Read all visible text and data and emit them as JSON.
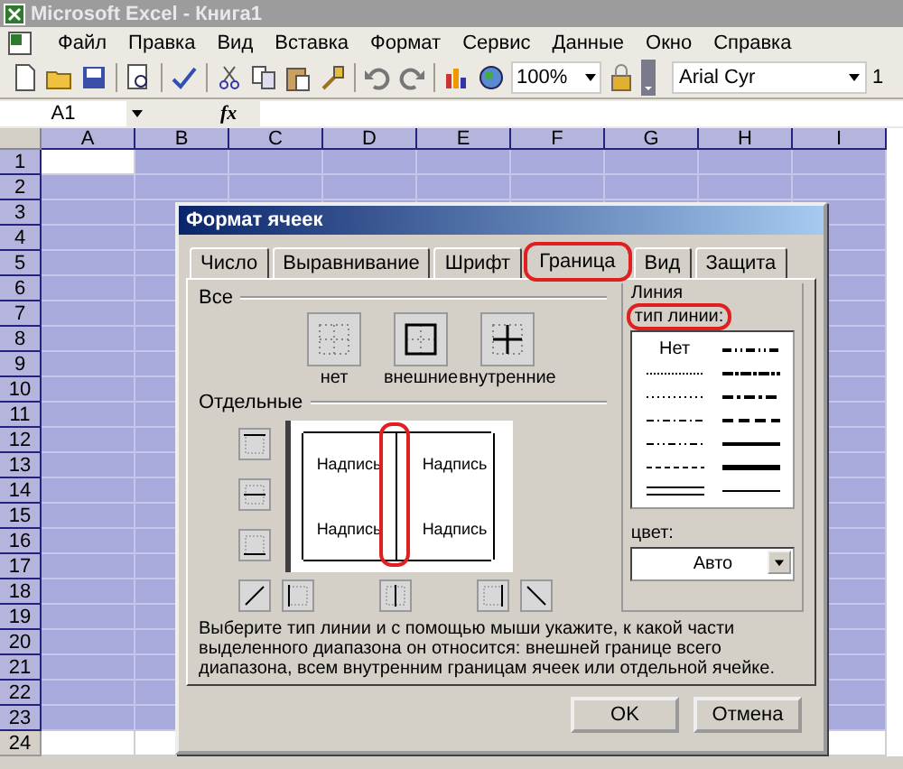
{
  "window": {
    "title": "Microsoft Excel - Книга1"
  },
  "menu": [
    "Файл",
    "Правка",
    "Вид",
    "Вставка",
    "Формат",
    "Сервис",
    "Данные",
    "Окно",
    "Справка"
  ],
  "toolbar": {
    "zoom": "100%",
    "font": "Arial Cyr",
    "font_size": "1"
  },
  "formula_bar": {
    "name_box": "A1",
    "fx": "fx"
  },
  "sheet": {
    "columns": [
      {
        "label": "A",
        "selected": true
      },
      {
        "label": "B",
        "selected": true
      },
      {
        "label": "C",
        "selected": true
      },
      {
        "label": "D",
        "selected": true
      },
      {
        "label": "E",
        "selected": true
      },
      {
        "label": "F",
        "selected": true
      },
      {
        "label": "G",
        "selected": true
      },
      {
        "label": "H",
        "selected": true
      },
      {
        "label": "I",
        "selected": true
      }
    ],
    "rows": [
      {
        "label": "1",
        "selected": true
      },
      {
        "label": "2",
        "selected": true
      },
      {
        "label": "3",
        "selected": true
      },
      {
        "label": "4",
        "selected": true
      },
      {
        "label": "5",
        "selected": true
      },
      {
        "label": "6",
        "selected": true
      },
      {
        "label": "7",
        "selected": true
      },
      {
        "label": "8",
        "selected": true
      },
      {
        "label": "9",
        "selected": true
      },
      {
        "label": "10",
        "selected": true
      },
      {
        "label": "11",
        "selected": true
      },
      {
        "label": "12",
        "selected": true
      },
      {
        "label": "13",
        "selected": true
      },
      {
        "label": "14",
        "selected": true
      },
      {
        "label": "15",
        "selected": true
      },
      {
        "label": "16",
        "selected": true
      },
      {
        "label": "17",
        "selected": true
      },
      {
        "label": "18",
        "selected": true
      },
      {
        "label": "19",
        "selected": true
      },
      {
        "label": "20",
        "selected": true
      },
      {
        "label": "21",
        "selected": true
      },
      {
        "label": "22",
        "selected": true
      },
      {
        "label": "23",
        "selected": true
      },
      {
        "label": "24",
        "selected": false
      }
    ]
  },
  "dialog": {
    "title": "Формат ячеек",
    "tabs": [
      {
        "label": "Число",
        "selected": false,
        "highlighted": false
      },
      {
        "label": "Выравнивание",
        "selected": false,
        "highlighted": false
      },
      {
        "label": "Шрифт",
        "selected": false,
        "highlighted": false
      },
      {
        "label": "Граница",
        "selected": true,
        "highlighted": true
      },
      {
        "label": "Вид",
        "selected": false,
        "highlighted": false
      },
      {
        "label": "Защита",
        "selected": false,
        "highlighted": false
      }
    ],
    "presets_label": "Все",
    "presets": [
      {
        "kind": "none",
        "label": "нет"
      },
      {
        "kind": "outline",
        "label": "внешние"
      },
      {
        "kind": "inside",
        "label": "внутренние"
      }
    ],
    "separate_label": "Отдельные",
    "preview": {
      "labels": [
        "Надпись",
        "Надпись",
        "Надпись",
        "Надпись"
      ],
      "highlighted": true
    },
    "line": {
      "title": "Линия",
      "type_label": "тип линии:",
      "type_highlighted": true,
      "styles": [
        {
          "kind": "none",
          "label": "Нет"
        },
        {
          "kind": "hair"
        },
        {
          "kind": "dotted"
        },
        {
          "kind": "dashdot"
        },
        {
          "kind": "dashdotdot"
        },
        {
          "kind": "dashed"
        },
        {
          "kind": "double"
        },
        {
          "kind": "medium-dashdotdot"
        },
        {
          "kind": "slanted"
        },
        {
          "kind": "medium-dashdot"
        },
        {
          "kind": "medium-dashed"
        },
        {
          "kind": "medium"
        },
        {
          "kind": "thick"
        },
        {
          "kind": "thin"
        }
      ],
      "color_label": "цвет:",
      "color_value": "Авто"
    },
    "help": "Выберите тип линии и с помощью мыши укажите, к какой части выделенного диапазона он относится: внешней границе всего диапазона, всем внутренним границам ячеек или отдельной ячейке.",
    "buttons": [
      "OK",
      "Отмена"
    ]
  }
}
